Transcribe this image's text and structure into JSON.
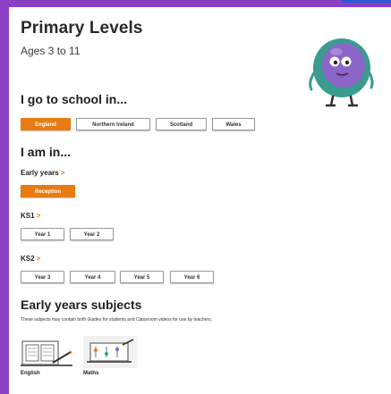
{
  "page": {
    "title": "Primary Levels",
    "subtitle": "Ages 3 to 11"
  },
  "school": {
    "heading": "I go to school in...",
    "options": [
      "England",
      "Northern Ireland",
      "Scotland",
      "Wales"
    ],
    "selected": "England"
  },
  "level": {
    "heading": "I am in...",
    "early_years": {
      "label": "Early years",
      "chevron": ">",
      "options": [
        "Reception"
      ],
      "selected": "Reception"
    },
    "ks1": {
      "label": "KS1",
      "chevron": ">",
      "options": [
        "Year 1",
        "Year 2"
      ]
    },
    "ks2": {
      "label": "KS2",
      "chevron": ">",
      "options": [
        "Year 3",
        "Year 4",
        "Year 5",
        "Year 6"
      ]
    }
  },
  "subjects": {
    "heading": "Early years subjects",
    "note": "These subjects may contain both Guides for students and Classroom videos for use by teachers.",
    "items": [
      {
        "label": "English",
        "icon": "english-icon"
      },
      {
        "label": "Maths",
        "icon": "maths-icon"
      }
    ]
  },
  "colors": {
    "frame": "#8a3fc4",
    "accent": "#e87b12",
    "top_tab": "#2a5bd7"
  }
}
